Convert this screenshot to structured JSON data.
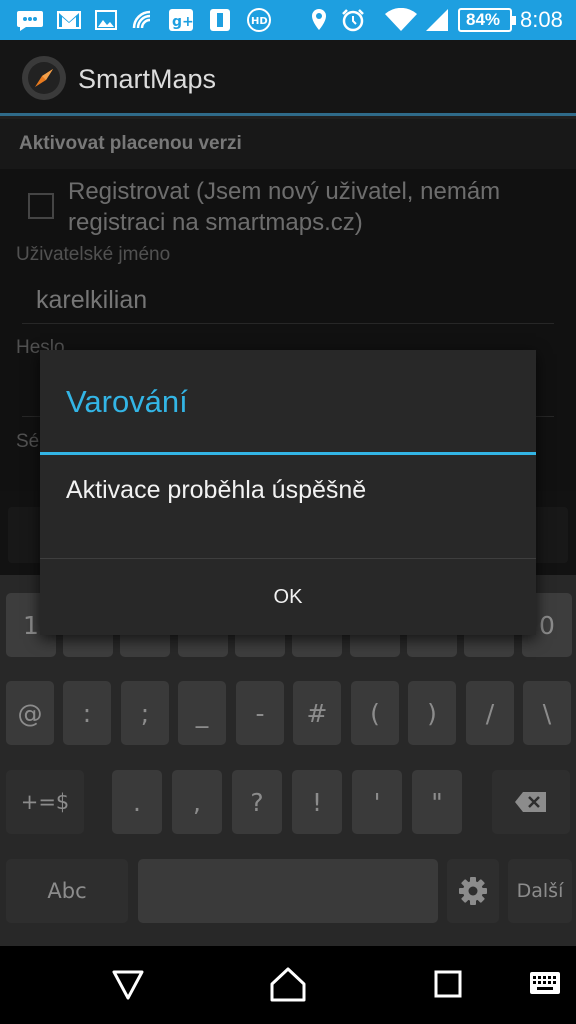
{
  "status_bar": {
    "battery": "84%",
    "time": "8:08",
    "icons": [
      "message-icon",
      "gmail-icon",
      "image-icon",
      "nfc-icon",
      "google-plus-icon",
      "app-icon",
      "hd-icon",
      "location-icon",
      "alarm-icon",
      "wifi-icon",
      "signal-icon",
      "battery-icon"
    ]
  },
  "app": {
    "title": "SmartMaps"
  },
  "page": {
    "section_header": "Aktivovat placenou verzi",
    "register_checkbox_label": "Registrovat (Jsem nový uživatel, nemám registraci na smartmaps.cz)",
    "register_checked": false,
    "username_label": "Uživatelské jméno",
    "username_value": "karelkilian",
    "password_label": "Heslo",
    "serial_label_partial": "Sé"
  },
  "keyboard": {
    "row1": [
      "1",
      "0"
    ],
    "row2": [
      "@",
      ":",
      ";",
      "_",
      "-",
      "#",
      "(",
      ")",
      "/",
      "\\"
    ],
    "row3": {
      "shift_label": "+=$",
      "keys": [
        ".",
        ",",
        "?",
        "!",
        "'",
        "\""
      ]
    },
    "row4": {
      "abc_label": "Abc",
      "next_label": "Další"
    }
  },
  "dialog": {
    "title": "Varování",
    "message": "Aktivace proběhla úspěšně",
    "ok_label": "OK"
  },
  "colors": {
    "status_bar": "#1e9fe0",
    "accent": "#33b5e5"
  }
}
